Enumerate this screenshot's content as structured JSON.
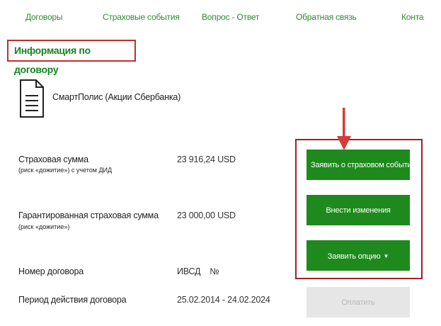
{
  "nav": {
    "items": [
      "Договоры",
      "Страховые события",
      "Вопрос - Ответ",
      "Обратная связь",
      "Конта"
    ]
  },
  "section": {
    "title": "Информация по договору"
  },
  "product": {
    "icon": "document-icon",
    "name": "СмартПолис (Акции Сбербанка)"
  },
  "fields": {
    "sum": {
      "label": "Страховая сумма",
      "sublabel": "(риск «дожитие») с учетом ДИД",
      "value": "23 916,24 USD"
    },
    "guaranteed": {
      "label": "Гарантированная страховая сумма",
      "sublabel": "(риск «дожитие»)",
      "value": "23 000,00 USD"
    },
    "number": {
      "label": "Номер договора",
      "value": "ИВСД    №"
    },
    "period": {
      "label": "Период действия договора",
      "value": "25.02.2014 - 24.02.2024"
    }
  },
  "actions": {
    "report_event": "Заявить о страховом событии",
    "make_changes": "Внести изменения",
    "declare_option": "Заявить опцию",
    "pay": "Оплатить"
  },
  "colors": {
    "accent_green": "#1e8a1e",
    "link_green": "#2e8b2e",
    "highlight_red": "#c0302c",
    "arrow_red": "#d83a3a",
    "disabled_gray": "#e6e6e6"
  },
  "icons": {
    "annotation_arrow": "down-arrow-icon",
    "dropdown": "caret-down-icon"
  }
}
